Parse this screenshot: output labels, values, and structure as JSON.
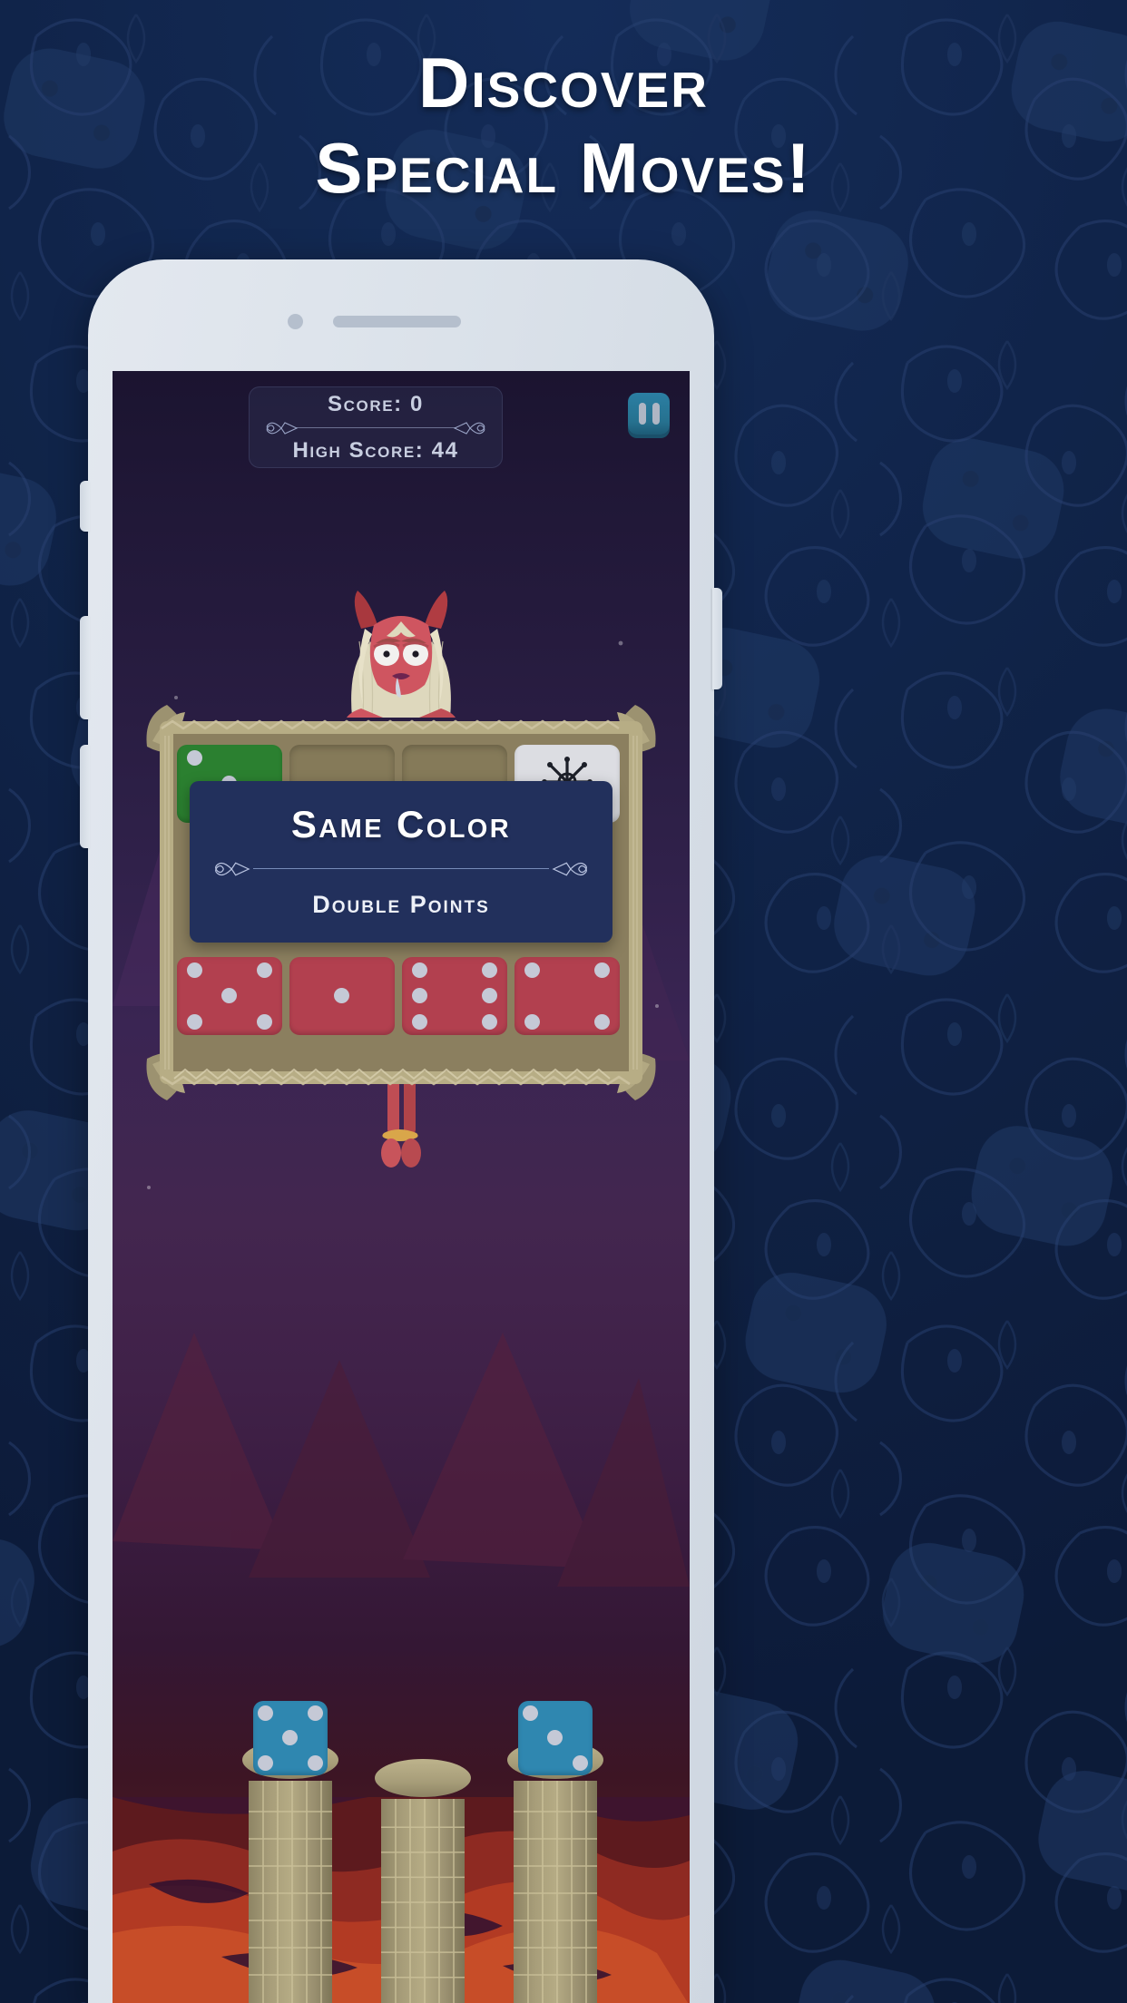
{
  "promo": {
    "headline_line1": "Discover",
    "headline_line2": "Special Moves!",
    "bg_color": "#12264c",
    "accent_color": "#22305c"
  },
  "device": {
    "frame_color": "#dde3eb",
    "camera": "camera-dot",
    "speaker": "earpiece-speaker",
    "buttons": [
      "silent-switch",
      "volume-up",
      "volume-down",
      "power"
    ]
  },
  "game": {
    "hud": {
      "score_label": "Score: 0",
      "high_score_label": "High Score: 44",
      "pause_icon": "pause-icon",
      "panel_color": "#292848"
    },
    "character": {
      "name": "demon-girl-character",
      "skin_color": "#c8505a",
      "hair_color": "#ded8bd",
      "horn_color": "#b03c42"
    },
    "tray": {
      "frame_color": "#b0a47d",
      "inner_color": "#8b7f5f",
      "top_row": [
        {
          "slot": 1,
          "state": "filled",
          "color": "green",
          "color_hex": "#2b8030",
          "value": 3,
          "pips": [
            1,
            0,
            0,
            0,
            1,
            0,
            0,
            0,
            1
          ]
        },
        {
          "slot": 2,
          "state": "empty",
          "color": "none",
          "color_hex": "#857a59",
          "value": 0,
          "pips": [
            0,
            0,
            0,
            0,
            0,
            0,
            0,
            0,
            0
          ]
        },
        {
          "slot": 3,
          "state": "empty",
          "color": "none",
          "color_hex": "#857a59",
          "value": 0,
          "pips": [
            0,
            0,
            0,
            0,
            0,
            0,
            0,
            0,
            0
          ]
        },
        {
          "slot": 4,
          "state": "filled",
          "color": "white",
          "color_hex": "#dcdde2",
          "value": "wild",
          "icon": "wild-star-icon",
          "pips": [
            0,
            0,
            0,
            0,
            0,
            0,
            0,
            0,
            0
          ]
        }
      ],
      "bottom_row": [
        {
          "slot": 1,
          "state": "filled",
          "color": "red",
          "color_hex": "#b2404f",
          "value": 5,
          "pips": [
            1,
            0,
            1,
            0,
            1,
            0,
            1,
            0,
            1
          ]
        },
        {
          "slot": 2,
          "state": "filled",
          "color": "red",
          "color_hex": "#b2404f",
          "value": 1,
          "pips": [
            0,
            0,
            0,
            0,
            1,
            0,
            0,
            0,
            0
          ]
        },
        {
          "slot": 3,
          "state": "filled",
          "color": "red",
          "color_hex": "#b2404f",
          "value": 6,
          "pips": [
            1,
            0,
            1,
            1,
            0,
            1,
            1,
            0,
            1
          ]
        },
        {
          "slot": 4,
          "state": "filled",
          "color": "red",
          "color_hex": "#b2404f",
          "value": 4,
          "pips": [
            1,
            0,
            1,
            0,
            0,
            0,
            1,
            0,
            1
          ]
        }
      ]
    },
    "move_card": {
      "title": "Same Color",
      "subtitle": "Double Points",
      "bg_color": "#22305c"
    },
    "pillars": [
      {
        "index": 1,
        "has_die": true,
        "die_color": "blue",
        "die_color_hex": "#2f87b0",
        "die_value": 5,
        "pips": [
          1,
          0,
          1,
          0,
          1,
          0,
          1,
          0,
          1
        ]
      },
      {
        "index": 2,
        "has_die": false,
        "die_color": "none",
        "die_color_hex": "",
        "die_value": 0,
        "pips": [
          0,
          0,
          0,
          0,
          0,
          0,
          0,
          0,
          0
        ]
      },
      {
        "index": 3,
        "has_die": true,
        "die_color": "blue",
        "die_color_hex": "#2f87b0",
        "die_value": 3,
        "pips": [
          1,
          0,
          0,
          0,
          1,
          0,
          0,
          0,
          1
        ]
      }
    ]
  }
}
